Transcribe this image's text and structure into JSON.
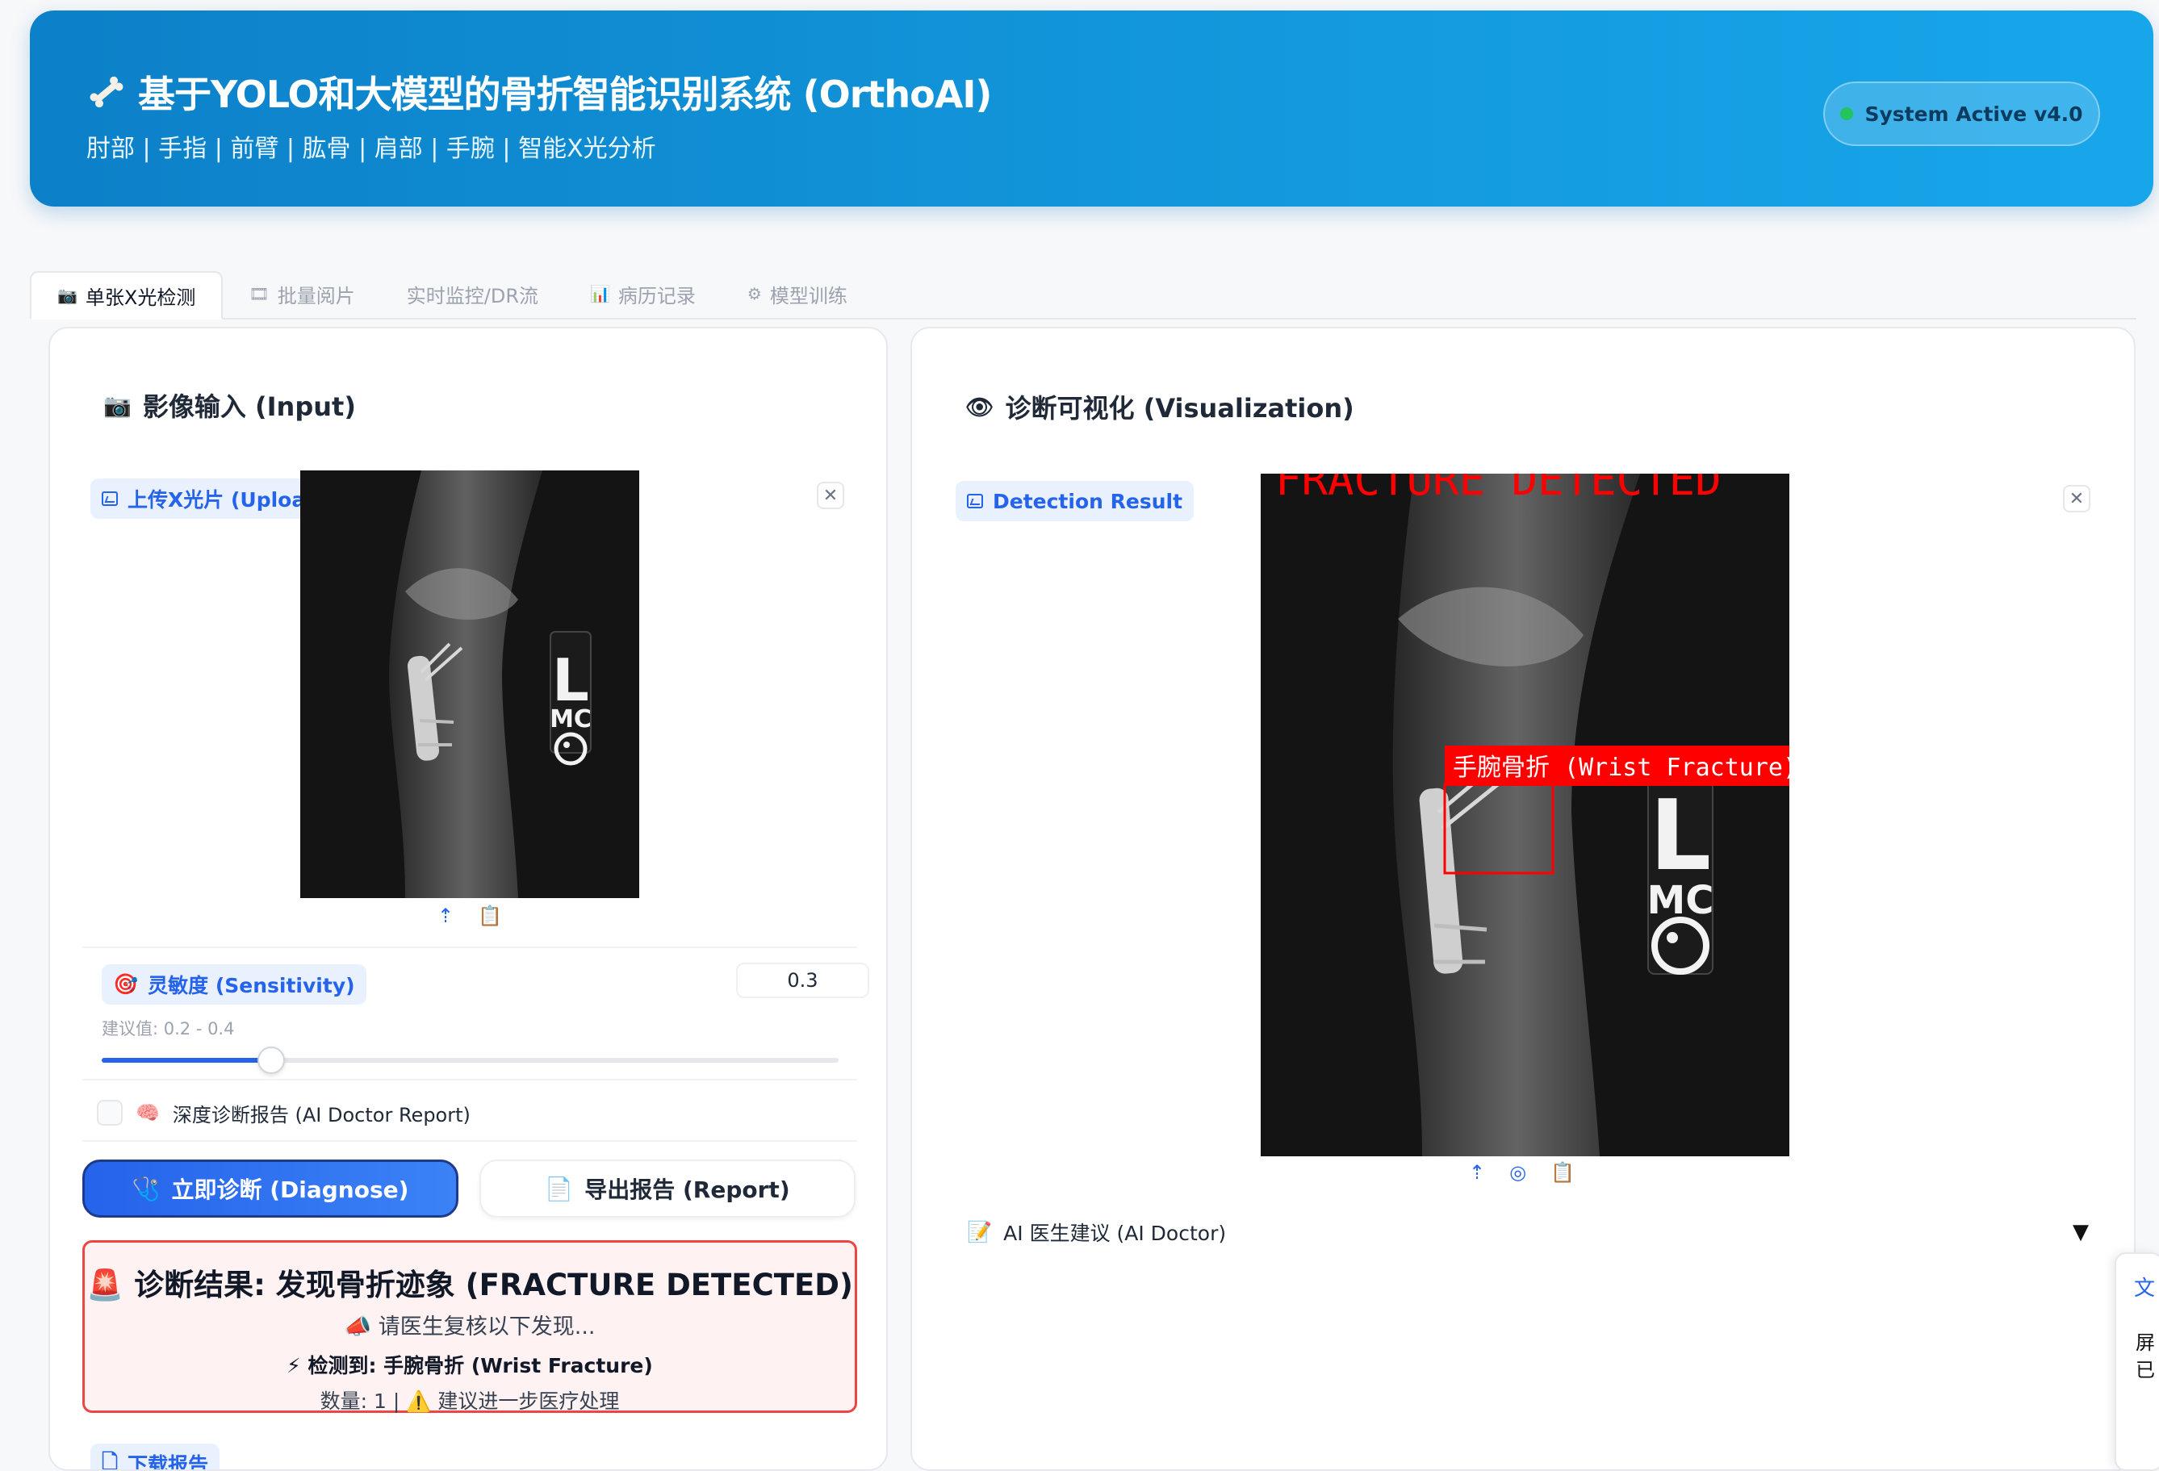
{
  "header": {
    "title": "基于YOLO和大模型的骨折智能识别系统 (OrthoAI)",
    "subtitle": "肘部 | 手指 | 前臂 | 肱骨 | 肩部 | 手腕 | 智能X光分析",
    "status": "System Active v4.0",
    "status_color": "#22c55e"
  },
  "tabs": [
    {
      "label": "单张X光检测",
      "icon": "camera-icon",
      "active": true
    },
    {
      "label": "批量阅片",
      "icon": "film-icon",
      "active": false
    },
    {
      "label": "实时监控/DR流",
      "icon": "",
      "active": false
    },
    {
      "label": "病历记录",
      "icon": "chart-icon",
      "active": false
    },
    {
      "label": "模型训练",
      "icon": "gear-icon",
      "active": false
    }
  ],
  "input_panel": {
    "title": "影像输入 (Input)",
    "upload_chip": "上传X光片 (Upload X-Ray)",
    "xray_marker": {
      "letter": "L",
      "initials": "MC"
    },
    "sensitivity": {
      "label": "灵敏度 (Sensitivity)",
      "value": "0.3",
      "hint": "建议值: 0.2 - 0.4",
      "fraction": 0.23
    },
    "ai_report_toggle": "深度诊断报告 (AI Doctor Report)",
    "diagnose_button": "立即诊断 (Diagnose)",
    "report_button": "导出报告 (Report)",
    "result": {
      "title": "诊断结果: 发现骨折迹象 (FRACTURE DETECTED)",
      "sub": "请医生复核以下发现...",
      "detected": "检测到: 手腕骨折 (Wrist Fracture)",
      "count": "数量: 1",
      "advice": "建议进一步医疗处理"
    },
    "download_chip": "下载报告"
  },
  "viz_panel": {
    "title": "诊断可视化 (Visualization)",
    "result_chip": "Detection Result",
    "overlay_banner": "FRACTURE DETECTED",
    "box_label": "手腕骨折 (Wrist Fracture)",
    "accordion": "AI 医生建议 (AI Doctor)",
    "accordion_caret": "▼",
    "accent_red": "#ff0000"
  },
  "side_widget": {
    "line1": "屏",
    "line2": "已"
  }
}
